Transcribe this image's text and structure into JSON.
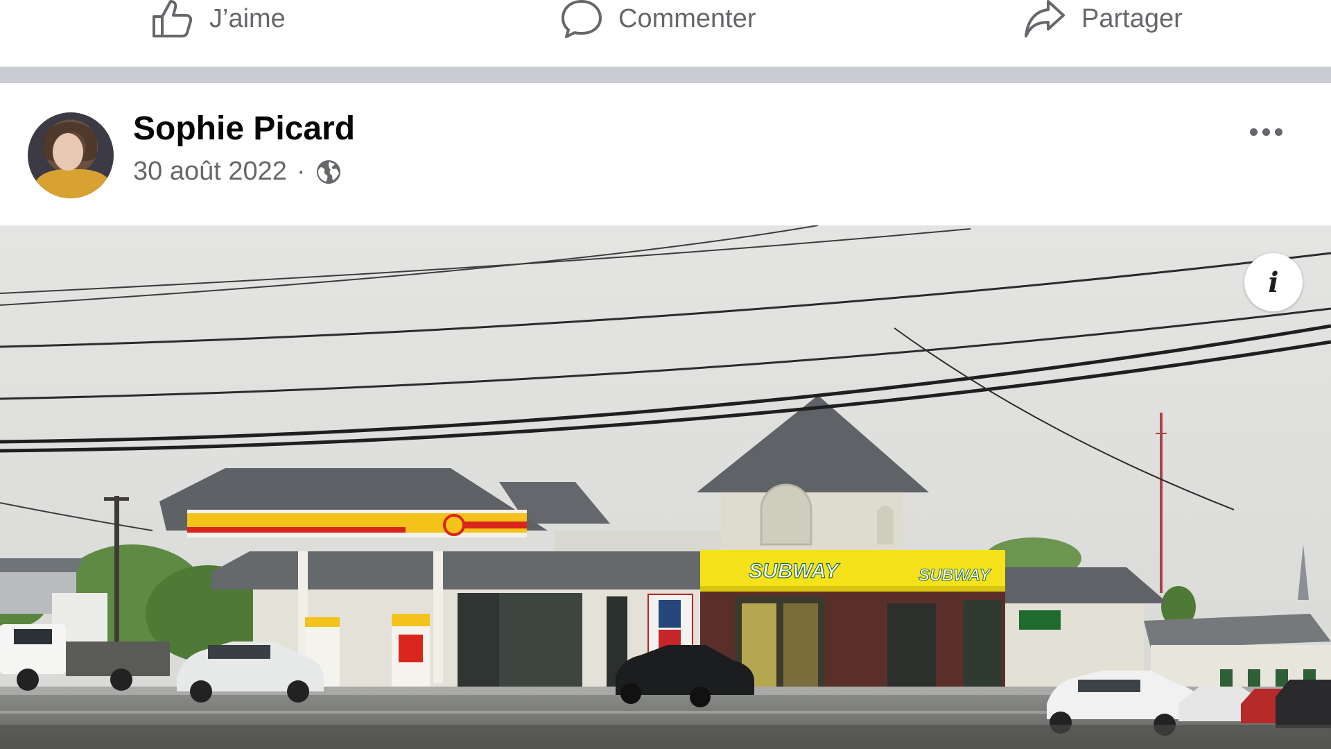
{
  "actions": {
    "like_label": "J’aime",
    "comment_label": "Commenter",
    "share_label": "Partager"
  },
  "post": {
    "author": "Sophie Picard",
    "date": "30 août 2022",
    "separator": "·",
    "privacy_icon": "globe-icon",
    "more_icon": "more-horizontal-icon"
  },
  "photo": {
    "info_label": "i",
    "signs": {
      "subway_main": "SUBWAY",
      "subway_small": "SUBWAY"
    }
  },
  "colors": {
    "secondary_text": "#65676b",
    "primary_text": "#050505",
    "separator": "#c9ccd1",
    "shell_yellow": "#f3c21b",
    "shell_red": "#d8261c",
    "subway_yellow": "#f6e21a"
  }
}
